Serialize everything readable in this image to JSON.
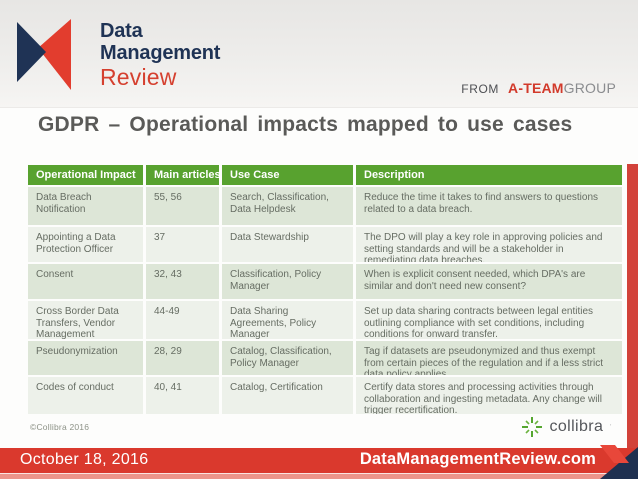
{
  "header": {
    "logo_text": {
      "line1": "Data",
      "line2": "Management",
      "line3": "Review"
    },
    "from_label": "FROM",
    "ateam_red": "A-TEAM",
    "ateam_gray": "GROUP"
  },
  "title": "GDPR – Operational impacts mapped to use cases",
  "table": {
    "columns": [
      "Operational Impact",
      "Main articles",
      "Use Case",
      "Description"
    ],
    "rows": [
      {
        "impact": "Data Breach Notification",
        "articles": "55, 56",
        "use_case": "Search, Classification, Data Helpdesk",
        "description": "Reduce the time it takes to find answers to questions related to a data breach."
      },
      {
        "impact": "Appointing a Data Protection Officer",
        "articles": "37",
        "use_case": "Data Stewardship",
        "description": "The DPO will play a key role in approving policies and setting standards and will be a stakeholder in remediating data breaches."
      },
      {
        "impact": "Consent",
        "articles": "32, 43",
        "use_case": "Classification, Policy Manager",
        "description": "When is explicit consent needed, which DPA's are similar and don't need new consent?"
      },
      {
        "impact": "Cross Border Data Transfers, Vendor Management",
        "articles": "44-49",
        "use_case": "Data Sharing Agreements, Policy Manager",
        "description": "Set up data sharing contracts between legal entities outlining compliance with set conditions, including conditions for onward transfer."
      },
      {
        "impact": "Pseudonymization",
        "articles": "28, 29",
        "use_case": "Catalog, Classification, Policy Manager",
        "description": "Tag if datasets are pseudonymized and thus exempt from certain pieces of the regulation and if a less strict data policy applies."
      },
      {
        "impact": "Codes of conduct",
        "articles": "40, 41",
        "use_case": "Catalog, Certification",
        "description": "Certify data stores and processing activities through collaboration and ingesting metadata. Any change will trigger recertification."
      }
    ]
  },
  "credit": "©Collibra 2016",
  "collibra_wordmark": "collibra",
  "footer": {
    "date": "October 18, 2016",
    "site": "DataManagementReview.com"
  },
  "colors": {
    "accent_red": "#da392d",
    "table_green": "#58a22f",
    "navy": "#1f3355",
    "row_odd": "#dde6d7",
    "row_even": "#edf1ea",
    "collibra_green": "#55a630"
  }
}
